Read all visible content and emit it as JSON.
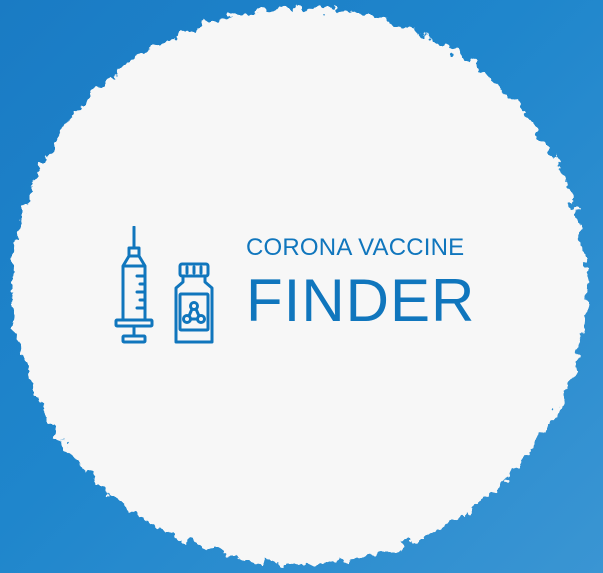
{
  "logo": {
    "subtitle": "CORONA VACCINE",
    "title": "FINDER",
    "icons": [
      "syringe-icon",
      "vaccine-vial-icon"
    ]
  },
  "colors": {
    "background": "#1f86cc",
    "badge": "#f7f7f7",
    "brand": "#1076bd"
  }
}
